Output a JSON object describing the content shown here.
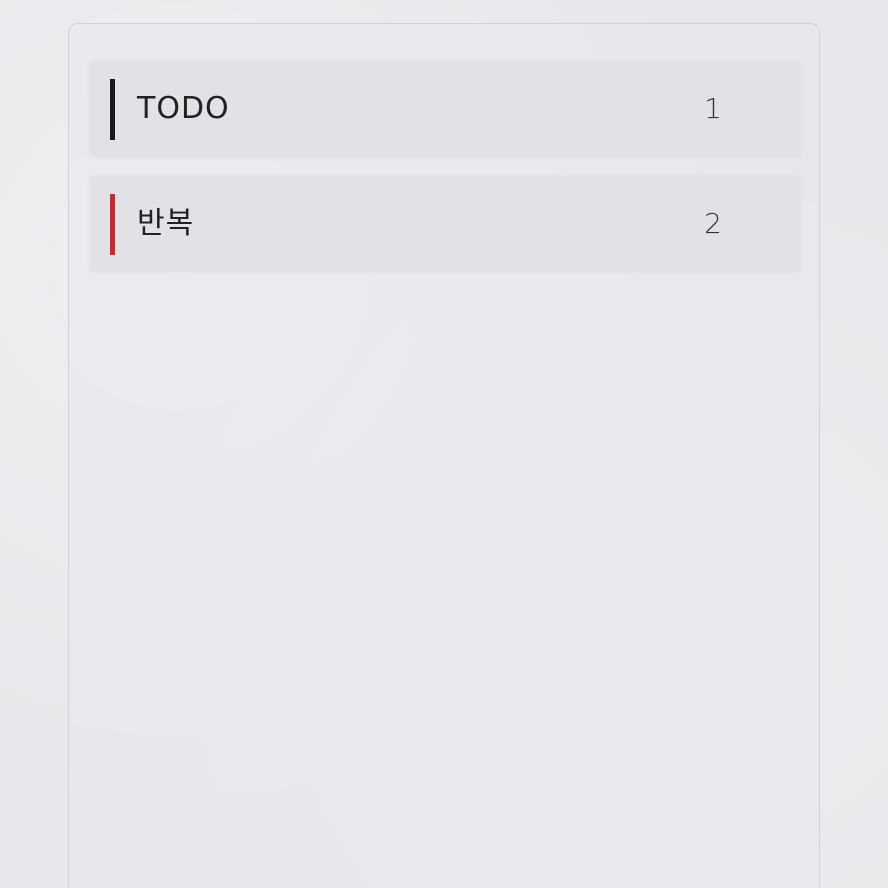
{
  "categories": [
    {
      "label": "TODO",
      "count": "1",
      "accent": "#1a1a1a"
    },
    {
      "label": "반복",
      "count": "2",
      "accent": "#b3342b"
    }
  ],
  "colors": {
    "background": "#e7e6ea",
    "panel_border": "#d2d1d5",
    "row_background": "#e0dfe4"
  }
}
